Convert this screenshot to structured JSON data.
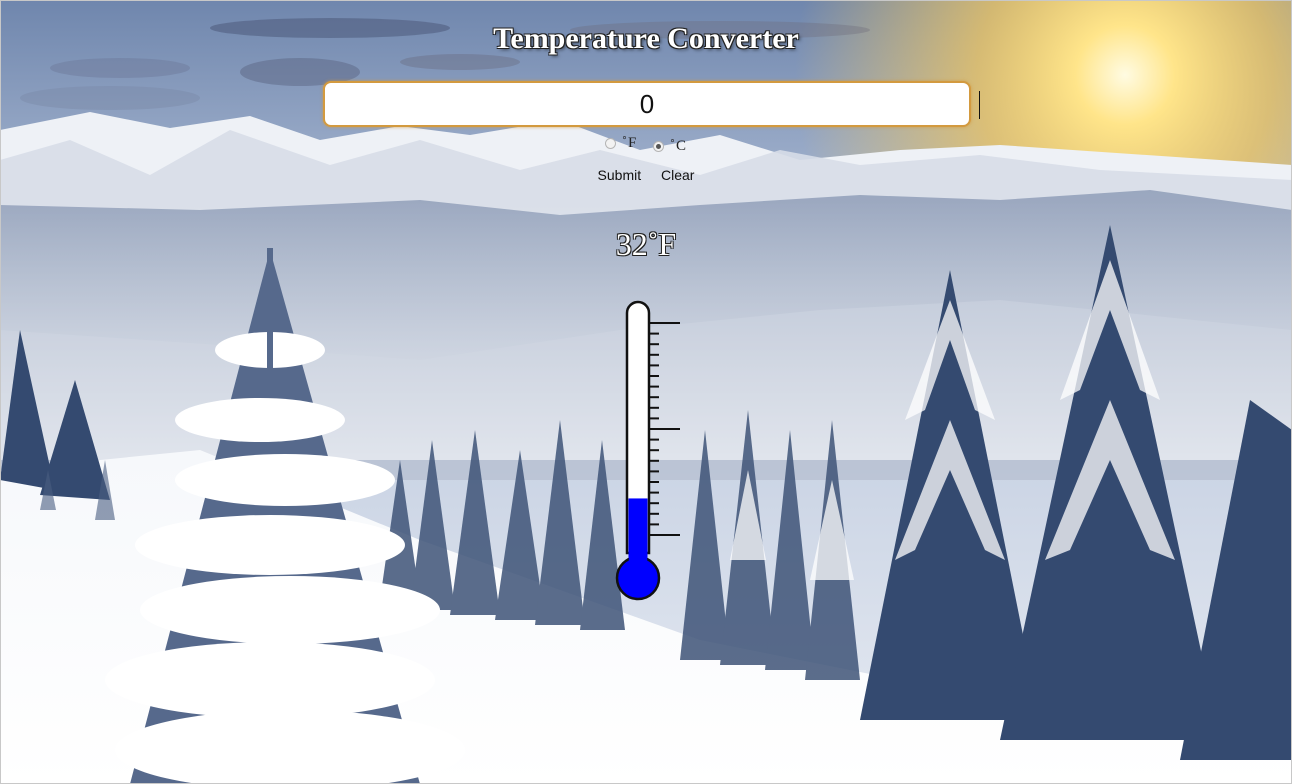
{
  "app": {
    "title": "Temperature Converter"
  },
  "form": {
    "input_value": "0",
    "units": [
      {
        "label": "˚F",
        "checked": false
      },
      {
        "label": "˚C",
        "checked": true
      }
    ],
    "submit_label": "Submit",
    "clear_label": "Clear"
  },
  "result": {
    "display": "32˚F"
  },
  "thermometer": {
    "fill_fraction": 0.24,
    "fill_color": "#0000ff"
  },
  "colors": {
    "input_border": "#d39a3f"
  }
}
